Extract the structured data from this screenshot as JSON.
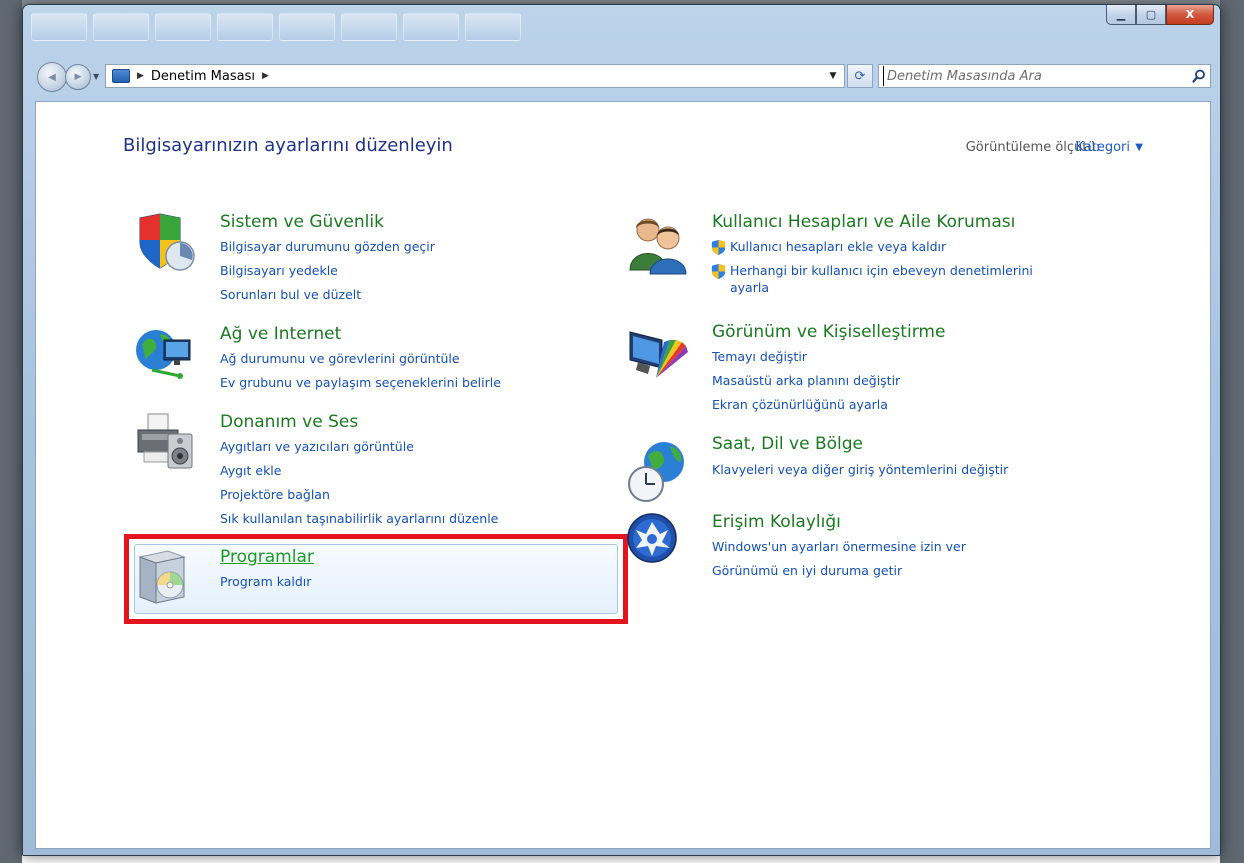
{
  "window": {
    "caption_buttons": {
      "minimize": "▁",
      "maximize": "▢",
      "close": "X"
    }
  },
  "nav": {
    "back_glyph": "◀",
    "forward_glyph": "▶",
    "dropdown_glyph": "▼"
  },
  "address": {
    "separator": "▶",
    "path": "Denetim Masası",
    "dropdown_glyph": "▼"
  },
  "refresh": {
    "glyph": "⟳"
  },
  "search": {
    "placeholder": "Denetim Masasında Ara"
  },
  "page": {
    "title": "Bilgisayarınızın ayarlarını düzenleyin",
    "view_by_label": "Görüntüleme ölçütü:",
    "view_by_value": "Kategori",
    "view_by_arrow": "▼"
  },
  "categories": {
    "system": {
      "title": "Sistem ve Güvenlik",
      "links": [
        "Bilgisayar durumunu gözden geçir",
        "Bilgisayarı yedekle",
        "Sorunları bul ve düzelt"
      ],
      "icon": "shield-icon"
    },
    "network": {
      "title": "Ağ ve Internet",
      "links": [
        "Ağ durumunu ve görevlerini görüntüle",
        "Ev grubunu ve paylaşım seçeneklerini belirle"
      ],
      "icon": "network-globe-icon"
    },
    "hardware": {
      "title": "Donanım ve Ses",
      "links": [
        "Aygıtları ve yazıcıları görüntüle",
        "Aygıt ekle",
        "Projektöre bağlan",
        "Sık kullanılan taşınabilirlik ayarlarını düzenle"
      ],
      "icon": "printer-speaker-icon"
    },
    "programs": {
      "title": "Programlar",
      "links": [
        "Program kaldır"
      ],
      "icon": "programs-box-icon"
    },
    "users": {
      "title": "Kullanıcı Hesapları ve Aile Koruması",
      "links": [
        "Kullanıcı hesapları ekle veya kaldır",
        "Herhangi bir kullanıcı için ebeveyn denetimlerini",
        "ayarla"
      ],
      "icon": "users-icon"
    },
    "appearance": {
      "title": "Görünüm ve Kişiselleştirme",
      "links": [
        "Temayı değiştir",
        "Masaüstü arka planını değiştir",
        "Ekran çözünürlüğünü ayarla"
      ],
      "icon": "monitor-palette-icon"
    },
    "clock": {
      "title": "Saat, Dil ve Bölge",
      "links": [
        "Klavyeleri veya diğer giriş yöntemlerini değiştir"
      ],
      "icon": "clock-globe-icon"
    },
    "ease": {
      "title": "Erişim Kolaylığı",
      "links": [
        "Windows'un ayarları önermesine izin ver",
        "Görünümü en iyi duruma getir"
      ],
      "icon": "ease-of-access-icon"
    }
  },
  "colors": {
    "category_title": "#1a7a20",
    "link": "#1351b4",
    "page_title": "#1e3287",
    "highlight": "#e3141e"
  }
}
